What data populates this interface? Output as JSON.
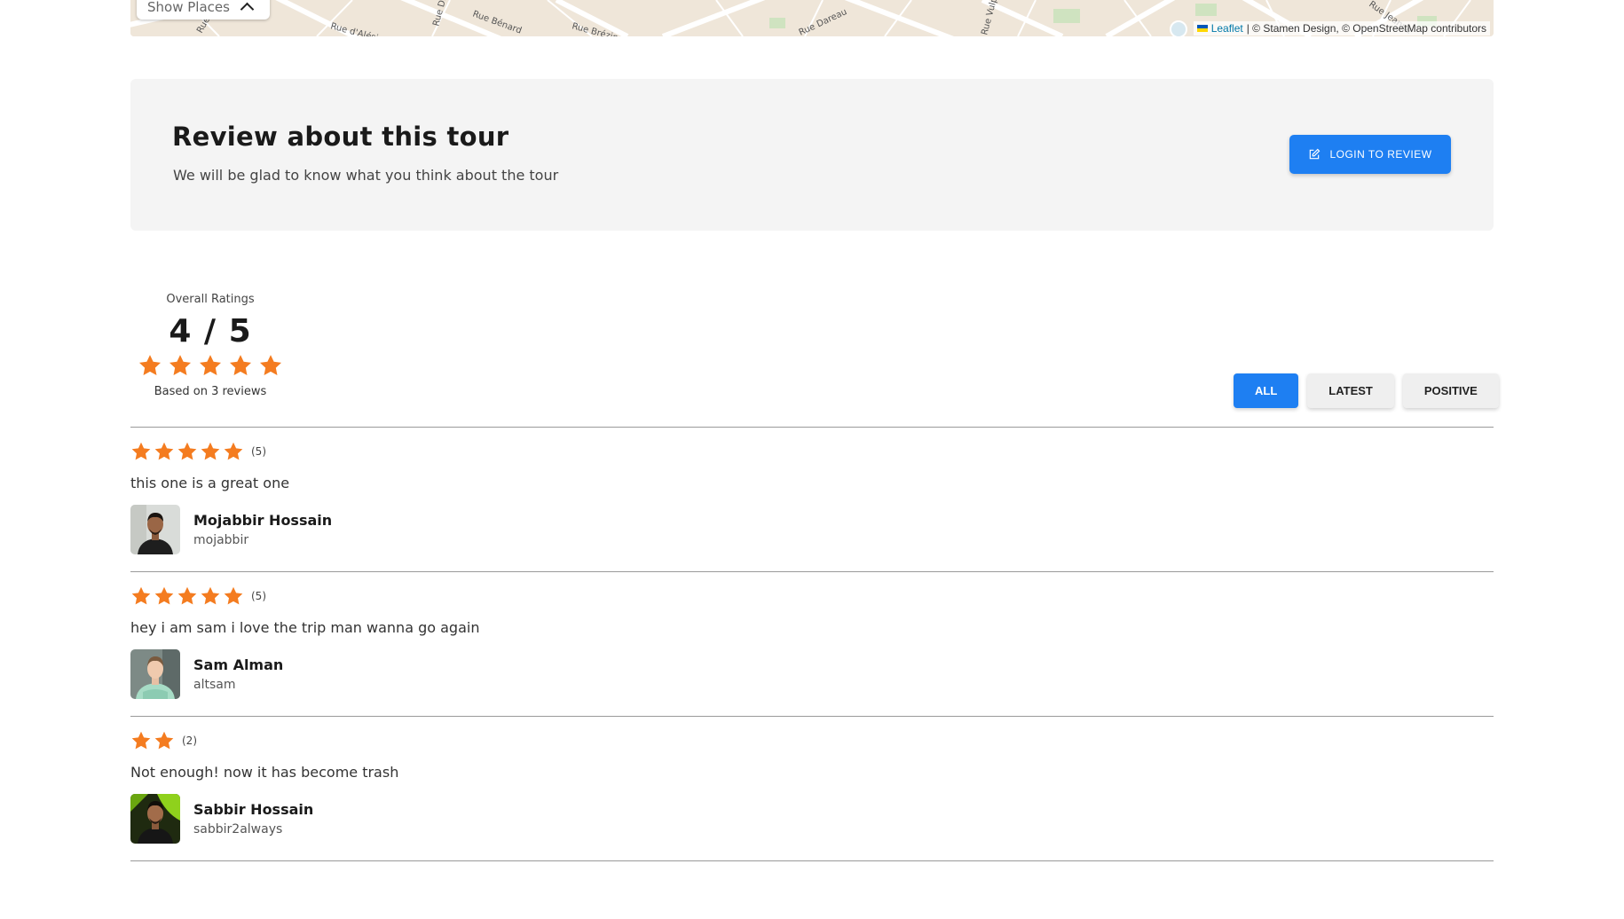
{
  "map": {
    "show_places_label": "Show Places",
    "street_labels": [
      "Rue Vercingétorix",
      "Rue d'Alésia",
      "Rue Didot",
      "Rue Bénard",
      "Rue Brézin",
      "Rue Dareau",
      "Rue Vulpian",
      "Rue Jeanne"
    ],
    "attribution_link": "Leaflet",
    "attribution_text": "| © Stamen Design, © OpenStreetMap contributors"
  },
  "cta": {
    "title": "Review about this tour",
    "subtitle": "We will be glad to know what you think about the tour",
    "login_label": "LOGIN TO REVIEW"
  },
  "overall": {
    "label": "Overall Ratings",
    "score": "4 / 5",
    "stars": 5,
    "based_on": "Based on 3 reviews"
  },
  "filters": [
    "ALL",
    "LATEST",
    "POSITIVE"
  ],
  "active_filter": "ALL",
  "reviews": [
    {
      "stars": 5,
      "count": "(5)",
      "text": "this one is a great one",
      "name": "Mojabbir Hossain",
      "handle": "mojabbir"
    },
    {
      "stars": 5,
      "count": "(5)",
      "text": "hey i am sam i love the trip man wanna go again",
      "name": "Sam Alman",
      "handle": "altsam"
    },
    {
      "stars": 2,
      "count": "(2)",
      "text": "Not enough! now it has become trash",
      "name": "Sabbir Hossain",
      "handle": "sabbir2always"
    }
  ],
  "colors": {
    "accent": "#1e7ff2",
    "star": "#f47c20"
  }
}
